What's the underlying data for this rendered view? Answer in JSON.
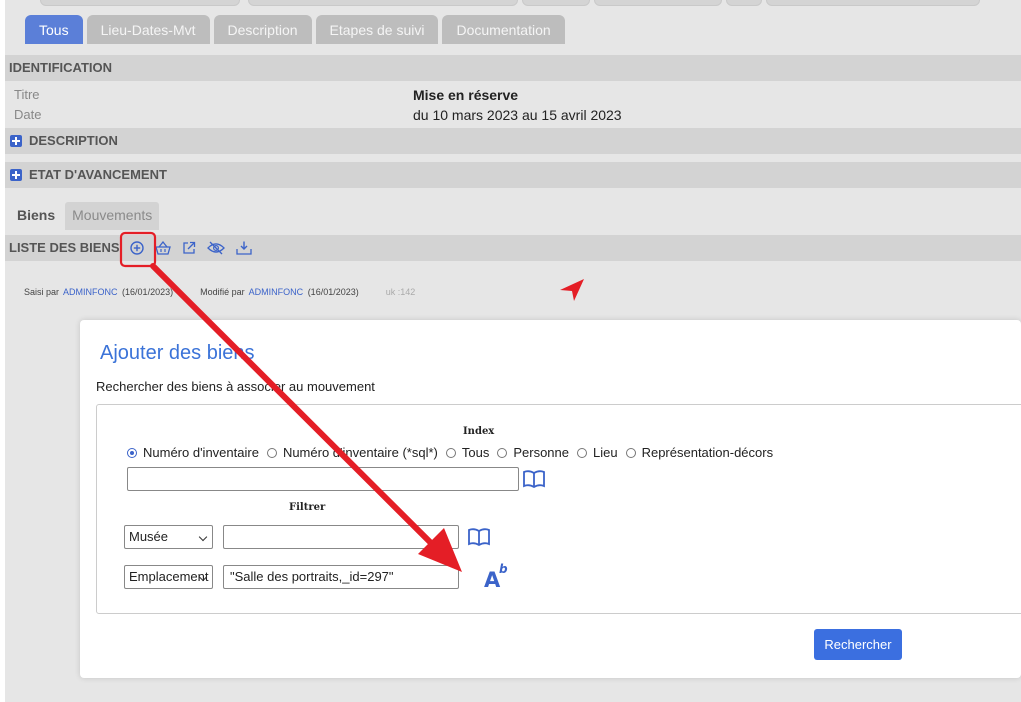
{
  "tabs": [
    {
      "label": "Tous",
      "active": true
    },
    {
      "label": "Lieu-Dates-Mvt",
      "active": false
    },
    {
      "label": "Description",
      "active": false
    },
    {
      "label": "Etapes de suivi",
      "active": false
    },
    {
      "label": "Documentation",
      "active": false
    }
  ],
  "identification": {
    "heading": "IDENTIFICATION",
    "rows": [
      {
        "label": "Titre",
        "value": "Mise en réserve"
      },
      {
        "label": "Date",
        "value": "du 10 mars 2023 au 15 avril 2023"
      }
    ]
  },
  "sections": {
    "description": "DESCRIPTION",
    "etat": "ETAT D'AVANCEMENT"
  },
  "subtabs": [
    {
      "label": "Biens",
      "active": true
    },
    {
      "label": "Mouvements",
      "active": false
    }
  ],
  "liste": {
    "heading": "LISTE DES BIENS",
    "icons": [
      "add-circle-icon",
      "basket-icon",
      "external-link-icon",
      "eye-off-icon",
      "download-icon"
    ]
  },
  "meta": {
    "saisi_label": "Saisi par",
    "saisi_user": "ADMINFONC",
    "saisi_date": "(16/01/2023)",
    "modifie_label": "Modifié par",
    "modifie_user": "ADMINFONC",
    "modifie_date": "(16/01/2023)",
    "uk": "uk :142"
  },
  "dialog": {
    "title": "Ajouter des biens",
    "subtitle": "Rechercher des biens à associer au mouvement",
    "index_label": "Index",
    "radios": [
      {
        "label": "Numéro d'inventaire",
        "checked": true
      },
      {
        "label": "Numéro d'inventaire (*sql*)",
        "checked": false
      },
      {
        "label": "Tous",
        "checked": false
      },
      {
        "label": "Personne",
        "checked": false
      },
      {
        "label": "Lieu",
        "checked": false
      },
      {
        "label": "Représentation-décors",
        "checked": false
      }
    ],
    "index_value": "",
    "filter_label": "Filtrer",
    "filters": [
      {
        "select": "Musée",
        "value": ""
      },
      {
        "select": "Emplacement",
        "value": "\"Salle des portraits,_id=297\""
      }
    ],
    "search_button": "Rechercher"
  },
  "colors": {
    "accent": "#3b63c9",
    "tab_active": "#5b7fd8",
    "annotation": "#e41e26"
  }
}
